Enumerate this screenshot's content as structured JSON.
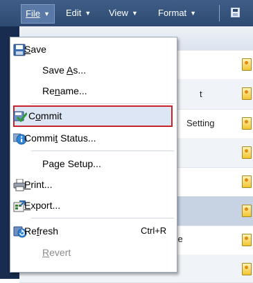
{
  "menubar": {
    "file": "File",
    "edit": "Edit",
    "view": "View",
    "format": "Format",
    "chevron": "▼",
    "save_icon": "save-icon"
  },
  "background": {
    "row_texts": [
      "t",
      "Setting",
      "age"
    ]
  },
  "file_menu": {
    "save": {
      "pre": "",
      "mn": "S",
      "post": "ave"
    },
    "save_as": {
      "pre": "Save ",
      "mn": "A",
      "post": "s..."
    },
    "rename": {
      "pre": "Re",
      "mn": "n",
      "post": "ame..."
    },
    "commit": {
      "pre": "C",
      "mn": "o",
      "post": "mmit"
    },
    "commit_status": {
      "pre": "Commi",
      "mn": "t",
      "post": " Status..."
    },
    "page_setup": {
      "pre": "Pa",
      "mn": "g",
      "post": "e Setup..."
    },
    "print": {
      "pre": "",
      "mn": "P",
      "post": "rint..."
    },
    "export": {
      "pre": "",
      "mn": "E",
      "post": "xport..."
    },
    "refresh": {
      "pre": "Re",
      "mn": "f",
      "post": "resh",
      "shortcut": "Ctrl+R"
    },
    "revert": {
      "pre": "",
      "mn": "R",
      "post": "evert"
    }
  },
  "colors": {
    "menubar": "#2d4a72",
    "highlight_border": "#c8232c",
    "highlight_fill": "#dce6f4"
  }
}
